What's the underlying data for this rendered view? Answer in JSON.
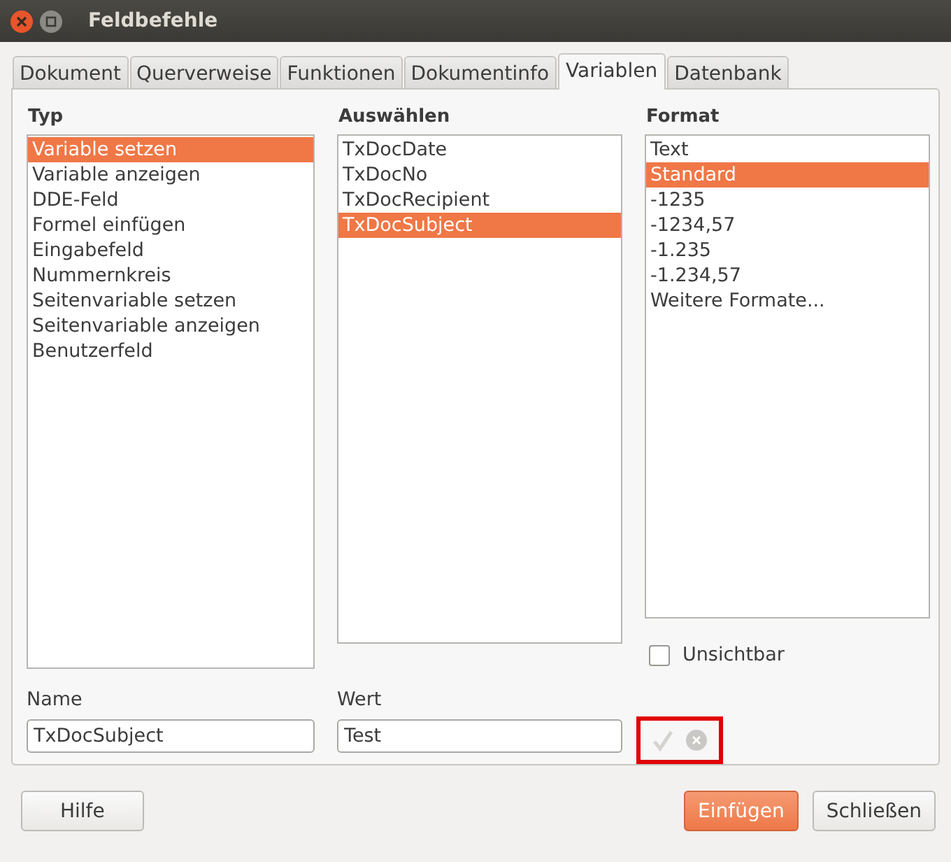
{
  "window": {
    "title": "Feldbefehle"
  },
  "tabs": [
    {
      "label": "Dokument",
      "selected": false
    },
    {
      "label": "Querverweise",
      "selected": false
    },
    {
      "label": "Funktionen",
      "selected": false
    },
    {
      "label": "Dokumentinfo",
      "selected": false
    },
    {
      "label": "Variablen",
      "selected": true
    },
    {
      "label": "Datenbank",
      "selected": false
    }
  ],
  "lists": [
    {
      "heading": "Typ",
      "items": [
        {
          "label": "Variable setzen",
          "selected": true
        },
        {
          "label": "Variable anzeigen",
          "selected": false
        },
        {
          "label": "DDE-Feld",
          "selected": false
        },
        {
          "label": "Formel einfügen",
          "selected": false
        },
        {
          "label": "Eingabefeld",
          "selected": false
        },
        {
          "label": "Nummernkreis",
          "selected": false
        },
        {
          "label": "Seitenvariable setzen",
          "selected": false
        },
        {
          "label": "Seitenvariable anzeigen",
          "selected": false
        },
        {
          "label": "Benutzerfeld",
          "selected": false
        }
      ]
    },
    {
      "heading": "Auswählen",
      "items": [
        {
          "label": "TxDocDate",
          "selected": false
        },
        {
          "label": "TxDocNo",
          "selected": false
        },
        {
          "label": "TxDocRecipient",
          "selected": false
        },
        {
          "label": "TxDocSubject",
          "selected": true
        }
      ]
    },
    {
      "heading": "Format",
      "items": [
        {
          "label": "Text",
          "selected": false
        },
        {
          "label": "Standard",
          "selected": true
        },
        {
          "label": "-1235",
          "selected": false
        },
        {
          "label": "-1234,57",
          "selected": false
        },
        {
          "label": "-1.235",
          "selected": false
        },
        {
          "label": "-1.234,57",
          "selected": false
        },
        {
          "label": "Weitere Formate...",
          "selected": false
        }
      ]
    }
  ],
  "invisible_checkbox": {
    "label": "Unsichtbar",
    "checked": false
  },
  "fields": [
    {
      "label": "Name",
      "value": "TxDocSubject"
    },
    {
      "label": "Wert",
      "value": "Test"
    }
  ],
  "value_actions": {
    "apply_disabled": true,
    "delete_disabled": true,
    "highlighted": true
  },
  "buttons": [
    {
      "label": "Hilfe",
      "kind": "plain"
    },
    {
      "label": "Einfügen",
      "kind": "primary"
    },
    {
      "label": "Schließen",
      "kind": "plain"
    }
  ]
}
